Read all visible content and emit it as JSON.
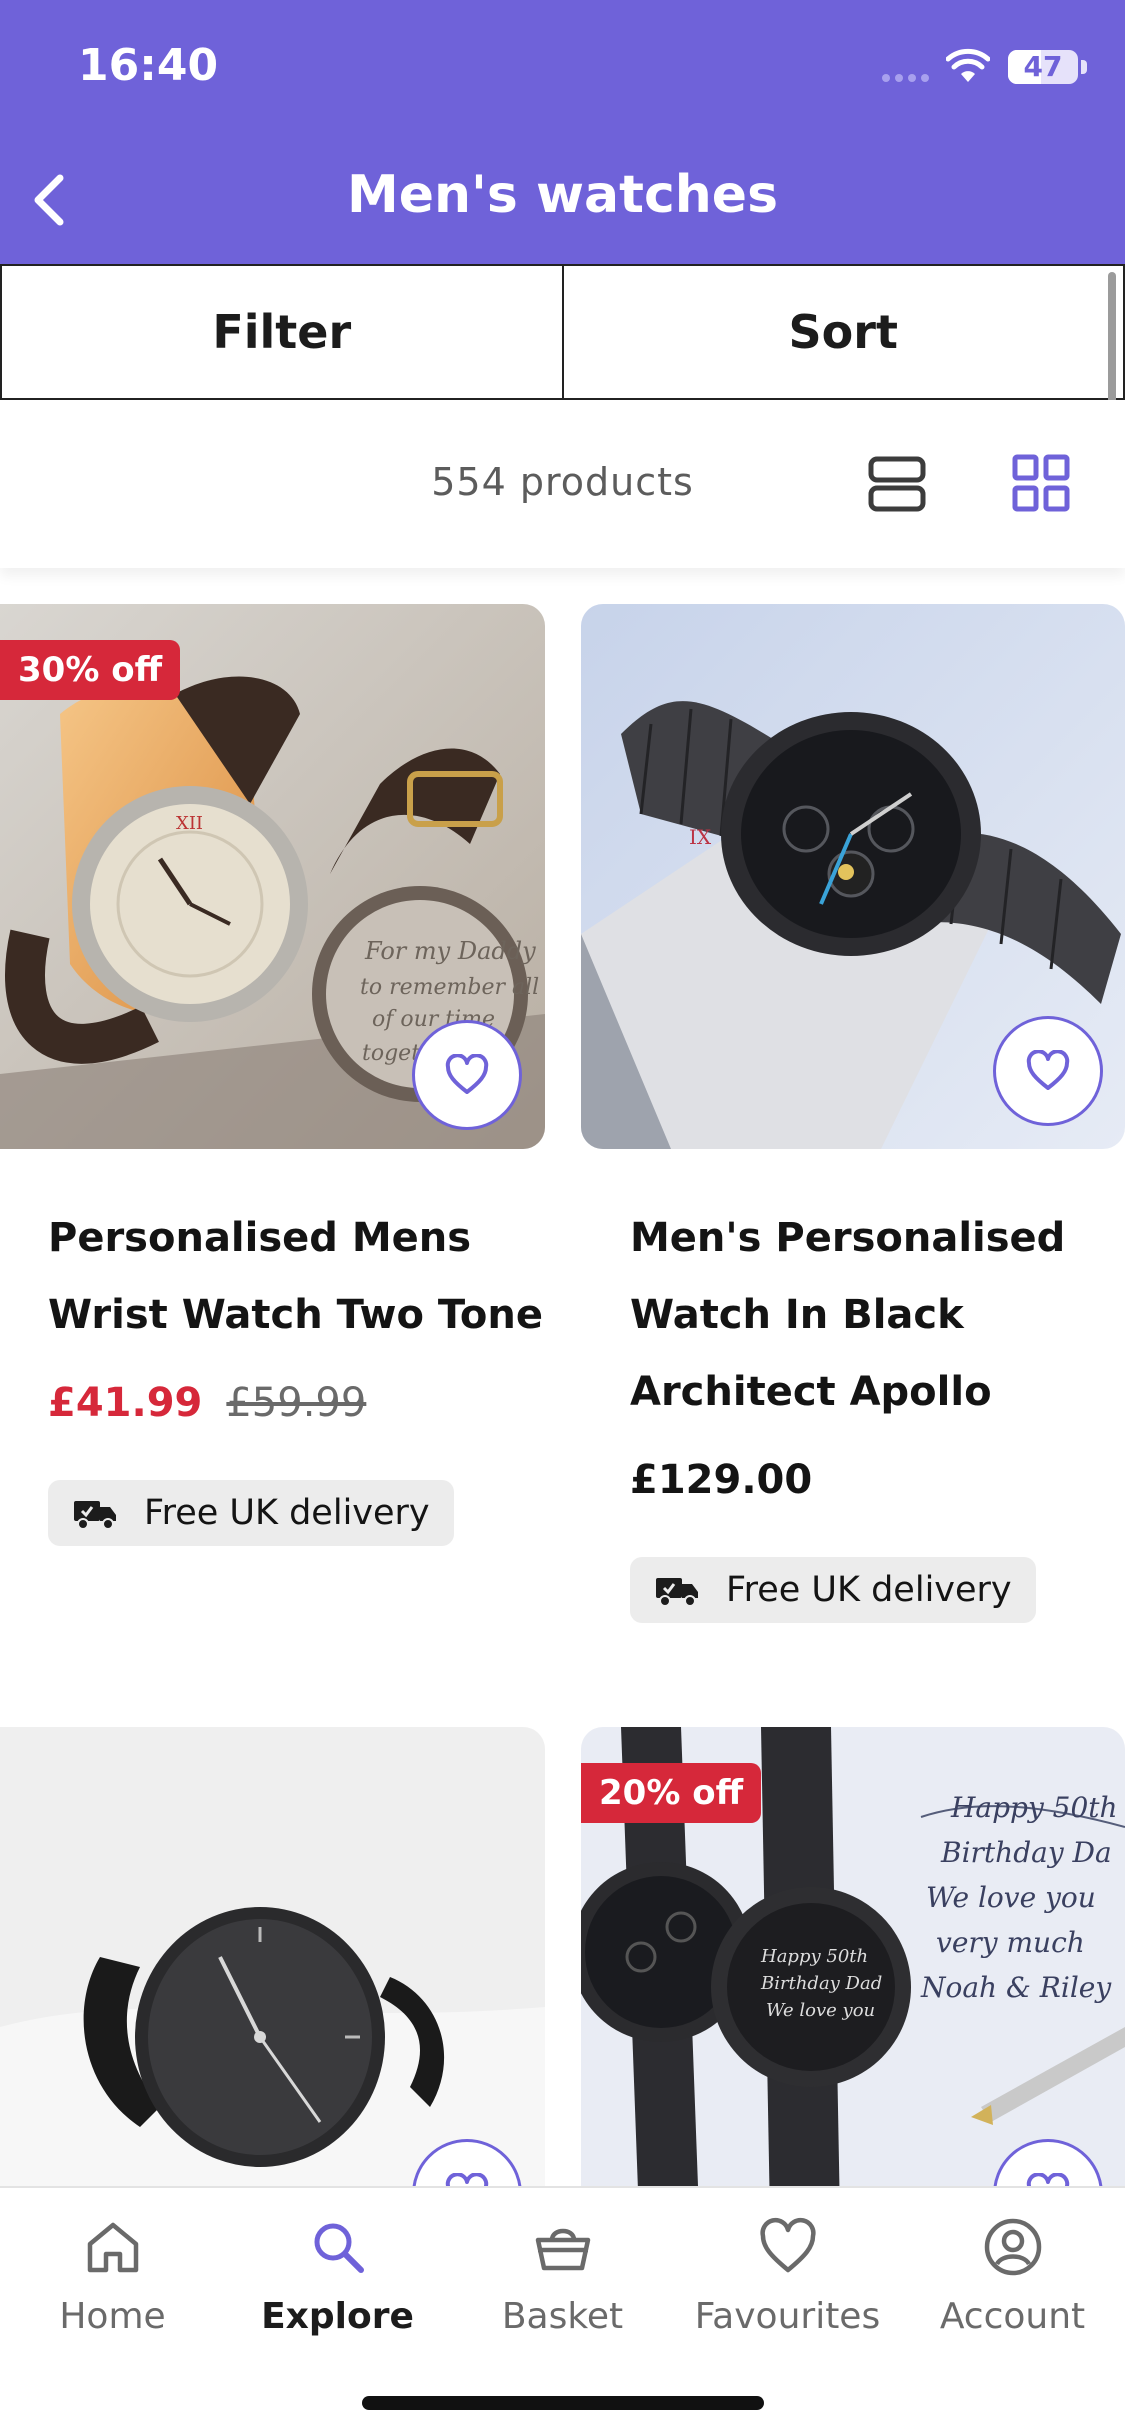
{
  "status_bar": {
    "time": "16:40",
    "battery": "47",
    "battery_level": 0.47
  },
  "header": {
    "title": "Men's watches",
    "back_icon": "chevron-left-icon"
  },
  "toolbar": {
    "filter_label": "Filter",
    "sort_label": "Sort"
  },
  "results": {
    "count_text": "554 products"
  },
  "products": [
    {
      "badge": "30% off",
      "title_line1": "Personalised Mens",
      "title_line2": "Wrist Watch Two Tone",
      "price": "£41.99",
      "was_price": "£59.99",
      "delivery": "Free UK delivery"
    },
    {
      "title_line1": "Men's Personalised",
      "title_line2": "Watch In Black",
      "title_line3": "Architect Apollo",
      "price": "£129.00",
      "delivery": "Free UK delivery"
    },
    {},
    {
      "badge": "20% off"
    }
  ],
  "nav": {
    "items": [
      {
        "label": "Home",
        "icon": "home-icon"
      },
      {
        "label": "Explore",
        "icon": "search-icon",
        "active": true
      },
      {
        "label": "Basket",
        "icon": "basket-icon"
      },
      {
        "label": "Favourites",
        "icon": "heart-icon"
      },
      {
        "label": "Account",
        "icon": "account-icon"
      }
    ]
  },
  "colors": {
    "brand": "#6f62d9",
    "sale": "#d6283a"
  }
}
